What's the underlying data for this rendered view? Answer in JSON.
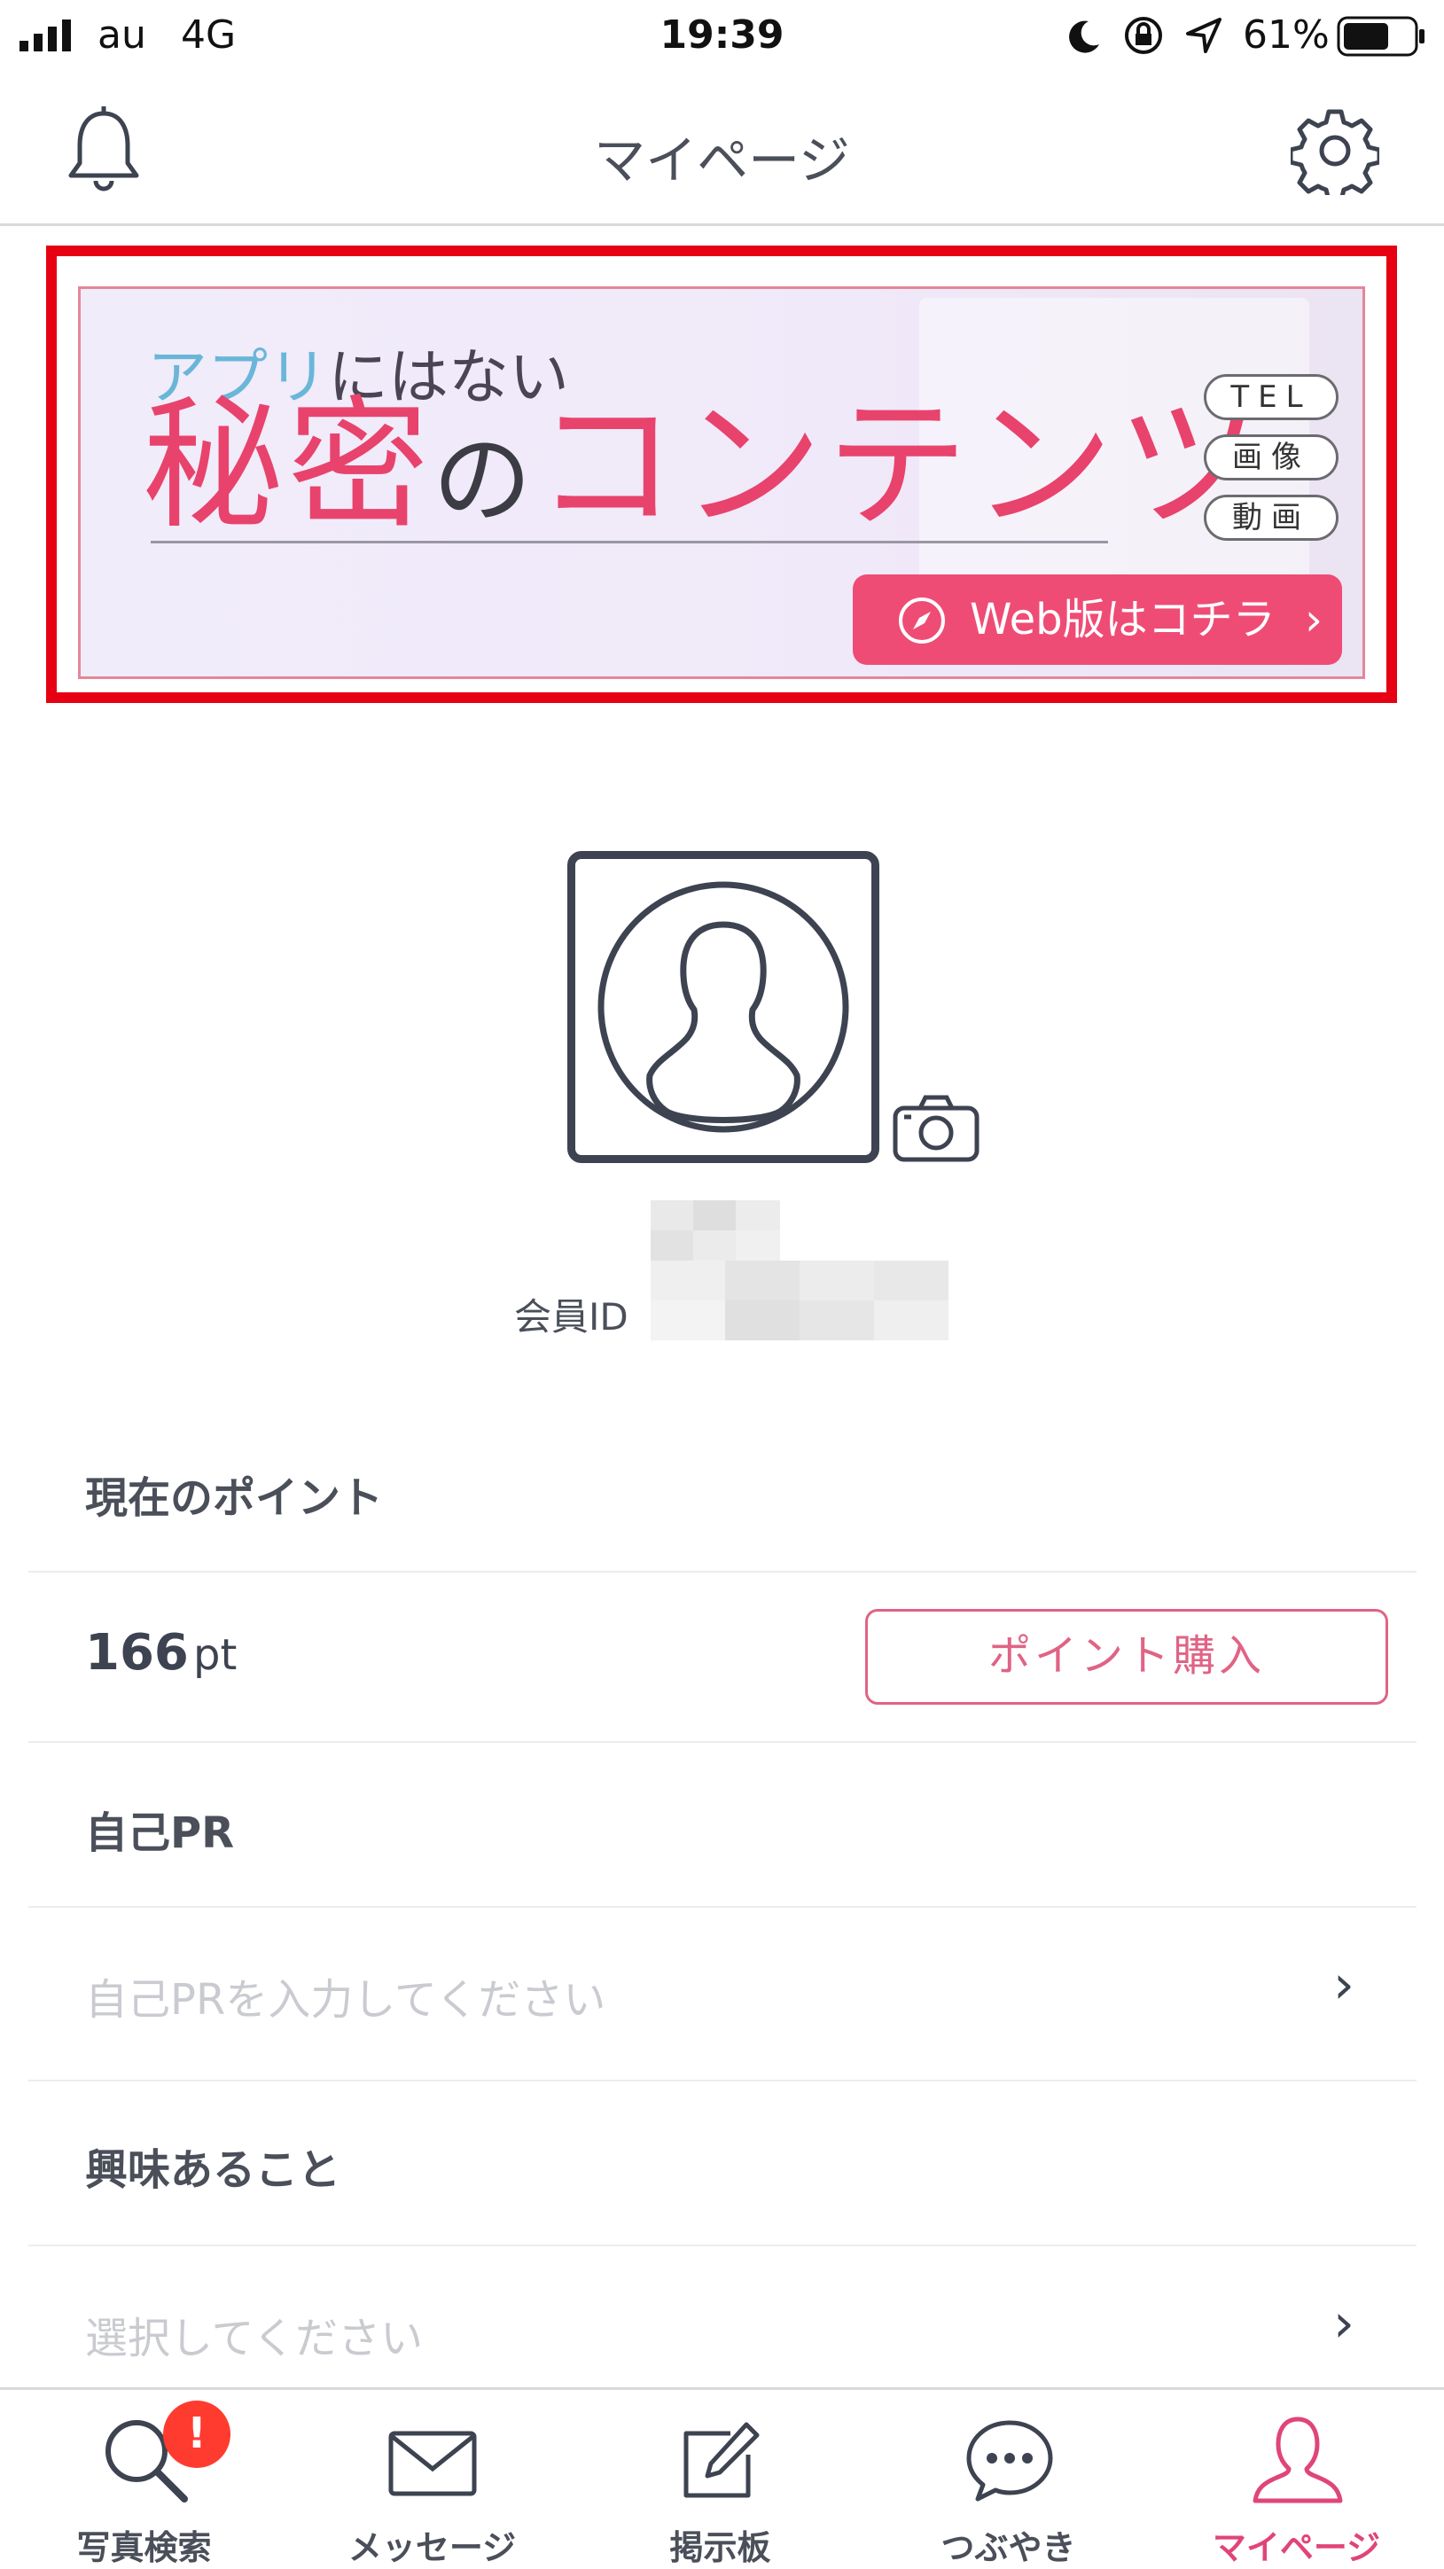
{
  "status_bar": {
    "carrier": "au",
    "network": "4G",
    "time": "19:39",
    "battery": "61%"
  },
  "header": {
    "title": "マイページ"
  },
  "banner": {
    "sub_a": "アプリ",
    "sub_b": "にはない",
    "main_a": "秘密",
    "main_b": "の",
    "main_c": "コンテンツ",
    "pills": [
      "TEL",
      "画像",
      "動画"
    ],
    "web_button": "Web版はコチラ"
  },
  "profile": {
    "member_id_label": "会員ID"
  },
  "points": {
    "heading": "現在のポイント",
    "value": "166",
    "unit": "pt",
    "buy_button": "ポイント購入"
  },
  "self_pr": {
    "heading": "自己PR",
    "placeholder": "自己PRを入力してください"
  },
  "interests": {
    "heading": "興味あること",
    "placeholder": "選択してください"
  },
  "tabs": [
    {
      "label": "写真検索",
      "badge": "!"
    },
    {
      "label": "メッセージ"
    },
    {
      "label": "掲示板"
    },
    {
      "label": "つぶやき"
    },
    {
      "label": "マイページ",
      "active": true
    }
  ],
  "colors": {
    "accent": "#e0457a",
    "banner_border": "#e60012",
    "badge": "#ff3b30"
  }
}
